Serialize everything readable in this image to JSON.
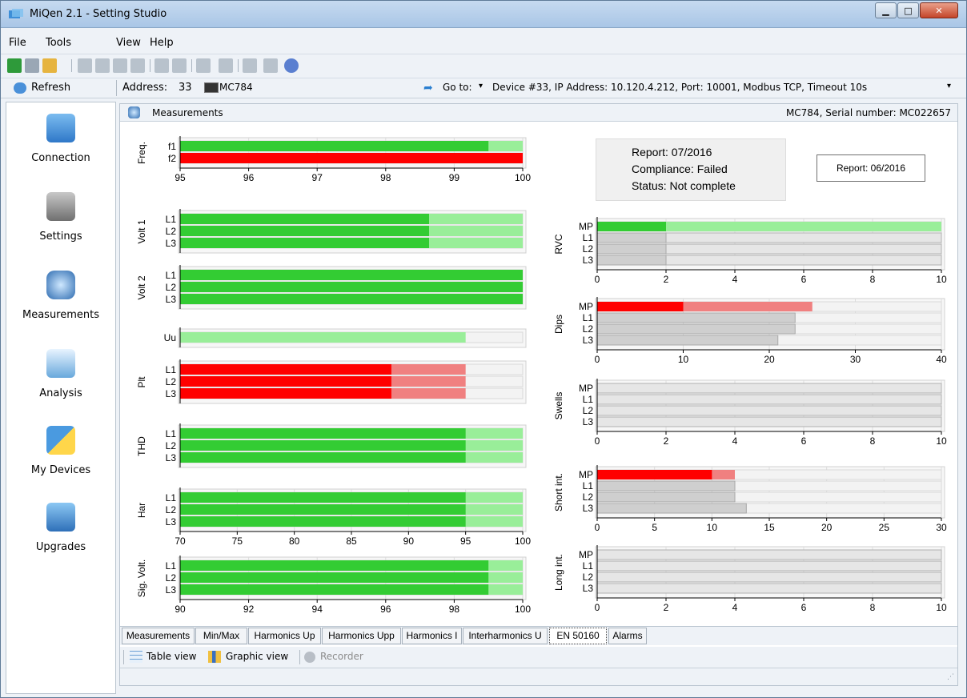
{
  "window": {
    "title": "MiQen 2.1 - Setting Studio"
  },
  "menu": [
    "File",
    "Tools",
    "View",
    "Help"
  ],
  "addressbar": {
    "refresh_label": "Refresh",
    "address_label": "Address:",
    "address_value": "33",
    "device_model": "MC784",
    "goto_label": "Go to:",
    "connection_text": "Device #33, IP Address: 10.120.4.212, Port: 10001, Modbus TCP, Timeout 10s"
  },
  "sidebar": {
    "items": [
      {
        "label": "Connection",
        "icon": "computer-icon"
      },
      {
        "label": "Settings",
        "icon": "gears-icon"
      },
      {
        "label": "Measurements",
        "icon": "gauge-icon"
      },
      {
        "label": "Analysis",
        "icon": "chart-icon"
      },
      {
        "label": "My Devices",
        "icon": "folder-star-icon"
      },
      {
        "label": "Upgrades",
        "icon": "disc-icon"
      }
    ]
  },
  "content": {
    "title": "Measurements",
    "device_info": "MC784, Serial number: MC022657"
  },
  "report": {
    "line1": "Report: 07/2016",
    "line2": "Compliance: Failed",
    "line3": "Status: Not complete",
    "prev_button": "Report: 06/2016"
  },
  "tabs": [
    "Measurements",
    "Min/Max",
    "Harmonics Up",
    "Harmonics Upp",
    "Harmonics I",
    "Interharmonics U",
    "EN 50160",
    "Alarms"
  ],
  "active_tab": "EN 50160",
  "viewbar": {
    "table_view": "Table view",
    "graphic_view": "Graphic view",
    "recorder": "Recorder"
  },
  "colors": {
    "green": "#33cc33",
    "light_green": "#99ee99",
    "red": "#ff0000",
    "light_red": "#f08080",
    "gray": "#cfcfcf",
    "empty": "#f3f3f3"
  },
  "chart_data": [
    {
      "type": "bar",
      "orientation": "horizontal",
      "ylabel": "Freq.",
      "categories": [
        "f1",
        "f2"
      ],
      "xlim": [
        95,
        100
      ],
      "tick_labels": [
        "95",
        "96",
        "97",
        "98",
        "99",
        "100"
      ],
      "bars": [
        {
          "value": 99.5,
          "max": 100,
          "color": "green"
        },
        {
          "value": 100,
          "max": 100,
          "color": "red"
        }
      ]
    },
    {
      "type": "bar",
      "orientation": "horizontal",
      "ylabel": "Volt 1",
      "categories": [
        "L1",
        "L2",
        "L3"
      ],
      "xlim": [
        70,
        100
      ],
      "bars": [
        {
          "value": 91.8,
          "max": 100,
          "color": "green"
        },
        {
          "value": 91.8,
          "max": 100,
          "color": "green"
        },
        {
          "value": 91.8,
          "max": 100,
          "color": "green"
        }
      ]
    },
    {
      "type": "bar",
      "orientation": "horizontal",
      "ylabel": "Volt 2",
      "categories": [
        "L1",
        "L2",
        "L3"
      ],
      "xlim": [
        70,
        100
      ],
      "bars": [
        {
          "value": 100,
          "max": 100,
          "color": "green"
        },
        {
          "value": 100,
          "max": 100,
          "color": "green"
        },
        {
          "value": 100,
          "max": 100,
          "color": "green"
        }
      ]
    },
    {
      "type": "bar",
      "orientation": "horizontal",
      "ylabel": "",
      "categories": [
        "Uu"
      ],
      "xlim": [
        70,
        100
      ],
      "bars": [
        {
          "value": 70,
          "max": 95,
          "color": "green"
        }
      ]
    },
    {
      "type": "bar",
      "orientation": "horizontal",
      "ylabel": "Plt",
      "categories": [
        "L1",
        "L2",
        "L3"
      ],
      "xlim": [
        70,
        100
      ],
      "bars": [
        {
          "value": 88.5,
          "max": 95,
          "color": "red"
        },
        {
          "value": 88.5,
          "max": 95,
          "color": "red"
        },
        {
          "value": 88.5,
          "max": 95,
          "color": "red"
        }
      ]
    },
    {
      "type": "bar",
      "orientation": "horizontal",
      "ylabel": "THD",
      "categories": [
        "L1",
        "L2",
        "L3"
      ],
      "xlim": [
        70,
        100
      ],
      "bars": [
        {
          "value": 95,
          "max": 100,
          "color": "green"
        },
        {
          "value": 95,
          "max": 100,
          "color": "green"
        },
        {
          "value": 95,
          "max": 100,
          "color": "green"
        }
      ]
    },
    {
      "type": "bar",
      "orientation": "horizontal",
      "ylabel": "Har",
      "categories": [
        "L1",
        "L2",
        "L3"
      ],
      "xlim": [
        70,
        100
      ],
      "tick_labels": [
        "70",
        "75",
        "80",
        "85",
        "90",
        "95",
        "100"
      ],
      "bars": [
        {
          "value": 95,
          "max": 100,
          "color": "green"
        },
        {
          "value": 95,
          "max": 100,
          "color": "green"
        },
        {
          "value": 95,
          "max": 100,
          "color": "green"
        }
      ]
    },
    {
      "type": "bar",
      "orientation": "horizontal",
      "ylabel": "Sig. Volt.",
      "categories": [
        "L1",
        "L2",
        "L3"
      ],
      "xlim": [
        90,
        100
      ],
      "tick_labels": [
        "90",
        "92",
        "94",
        "96",
        "98",
        "100"
      ],
      "bars": [
        {
          "value": 99,
          "max": 100,
          "color": "green"
        },
        {
          "value": 99,
          "max": 100,
          "color": "green"
        },
        {
          "value": 99,
          "max": 100,
          "color": "green"
        }
      ]
    },
    {
      "type": "bar",
      "orientation": "horizontal",
      "ylabel": "RVC",
      "categories": [
        "MP",
        "L1",
        "L2",
        "L3"
      ],
      "xlim": [
        0,
        10
      ],
      "tick_labels": [
        "0",
        "2",
        "4",
        "6",
        "8",
        "10"
      ],
      "bars": [
        {
          "value": 2,
          "max": 10,
          "color": "green"
        },
        {
          "value": 2,
          "max": 10,
          "color": "gray"
        },
        {
          "value": 2,
          "max": 10,
          "color": "gray"
        },
        {
          "value": 2,
          "max": 10,
          "color": "gray"
        }
      ]
    },
    {
      "type": "bar",
      "orientation": "horizontal",
      "ylabel": "Dips",
      "categories": [
        "MP",
        "L1",
        "L2",
        "L3"
      ],
      "xlim": [
        0,
        40
      ],
      "tick_labels": [
        "0",
        "10",
        "20",
        "30",
        "40"
      ],
      "bars": [
        {
          "value": 10,
          "max": 25,
          "color": "red"
        },
        {
          "value": 23,
          "max": 23,
          "color": "gray"
        },
        {
          "value": 23,
          "max": 23,
          "color": "gray"
        },
        {
          "value": 21,
          "max": 21,
          "color": "gray"
        }
      ]
    },
    {
      "type": "bar",
      "orientation": "horizontal",
      "ylabel": "Swells",
      "categories": [
        "MP",
        "L1",
        "L2",
        "L3"
      ],
      "xlim": [
        0,
        10
      ],
      "tick_labels": [
        "0",
        "2",
        "4",
        "6",
        "8",
        "10"
      ],
      "bars": [
        {
          "value": 0,
          "max": 10,
          "color": "gray"
        },
        {
          "value": 0,
          "max": 10,
          "color": "gray"
        },
        {
          "value": 0,
          "max": 10,
          "color": "gray"
        },
        {
          "value": 0,
          "max": 10,
          "color": "gray"
        }
      ]
    },
    {
      "type": "bar",
      "orientation": "horizontal",
      "ylabel": "Short int.",
      "categories": [
        "MP",
        "L1",
        "L2",
        "L3"
      ],
      "xlim": [
        0,
        30
      ],
      "tick_labels": [
        "0",
        "5",
        "10",
        "15",
        "20",
        "25",
        "30"
      ],
      "bars": [
        {
          "value": 10,
          "max": 12,
          "color": "red"
        },
        {
          "value": 12,
          "max": 12,
          "color": "gray"
        },
        {
          "value": 12,
          "max": 12,
          "color": "gray"
        },
        {
          "value": 13,
          "max": 13,
          "color": "gray"
        }
      ]
    },
    {
      "type": "bar",
      "orientation": "horizontal",
      "ylabel": "Long int.",
      "categories": [
        "MP",
        "L1",
        "L2",
        "L3"
      ],
      "xlim": [
        0,
        10
      ],
      "tick_labels": [
        "0",
        "2",
        "4",
        "6",
        "8",
        "10"
      ],
      "bars": [
        {
          "value": 0,
          "max": 10,
          "color": "gray"
        },
        {
          "value": 0,
          "max": 10,
          "color": "gray"
        },
        {
          "value": 0,
          "max": 10,
          "color": "gray"
        },
        {
          "value": 0,
          "max": 10,
          "color": "gray"
        }
      ]
    }
  ]
}
